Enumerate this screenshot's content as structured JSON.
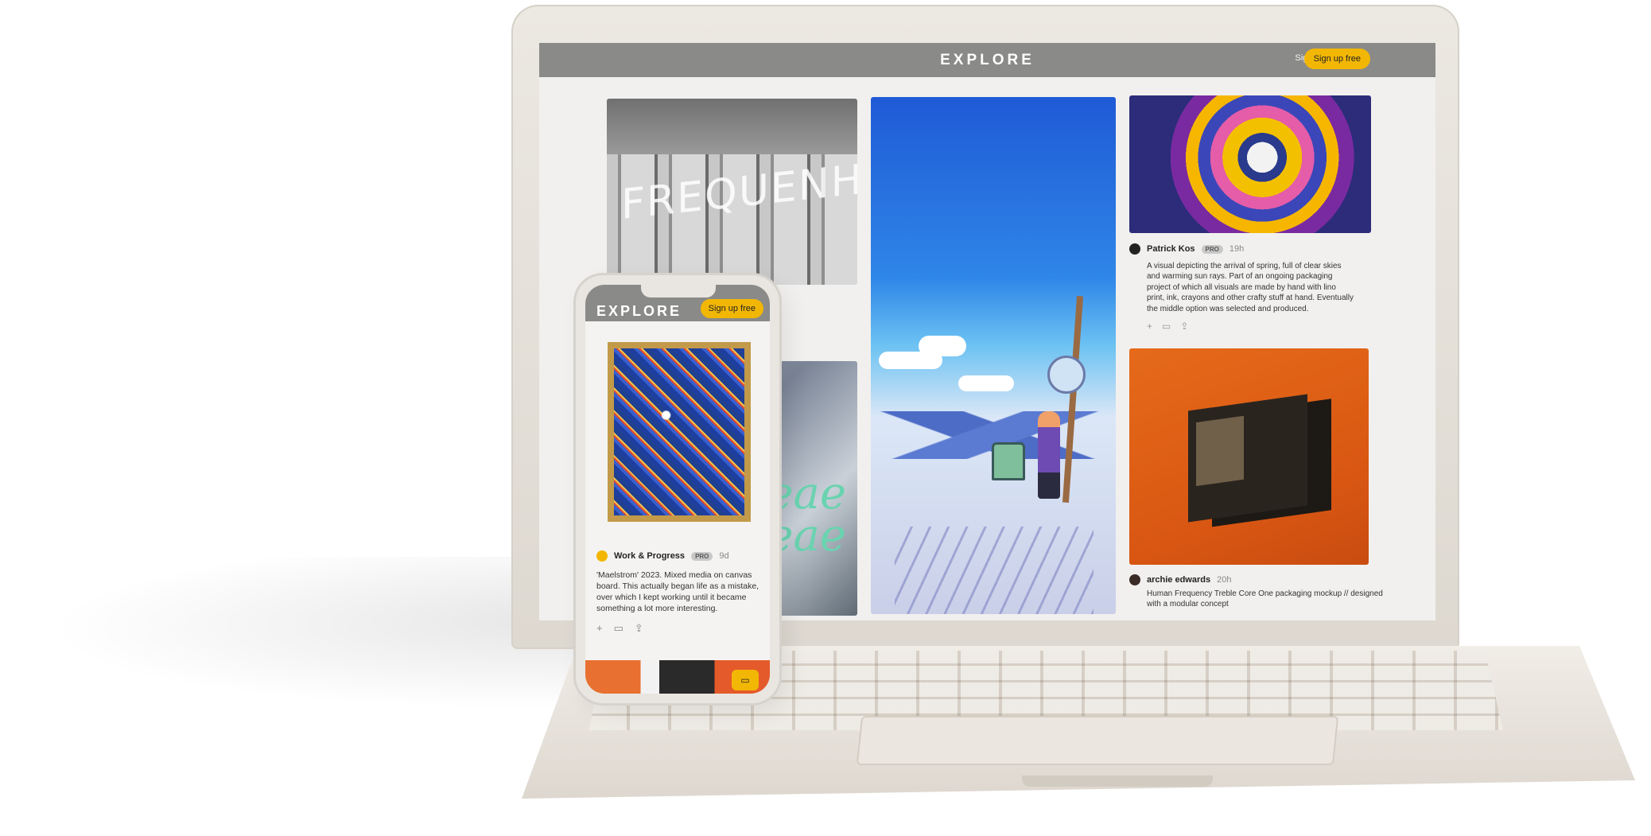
{
  "header": {
    "brand": "EXPLORE",
    "signin": "Sign in",
    "signup": "Sign up free"
  },
  "cards": {
    "frequency": {
      "text": "FREQUENHZ"
    },
    "overlay_text": "eae\neae",
    "post1": {
      "author": "Patrick Kos",
      "badge": "PRO",
      "time": "19h",
      "description": "A visual depicting the arrival of spring, full of clear skies and warming sun rays. Part of an ongoing packaging project of which all visuals are made by hand with lino print, ink, crayons and other crafty stuff at hand. Eventually the middle option was selected and produced."
    },
    "post2": {
      "author": "archie edwards",
      "time": "20h",
      "description": "Human Frequency Treble Core One packaging mockup // designed with a modular concept"
    }
  },
  "phone": {
    "brand": "EXPLORE",
    "signup": "Sign up free",
    "post": {
      "author": "Work & Progress",
      "badge": "PRO",
      "time": "9d",
      "description": "'Maelstrom' 2023. Mixed media on canvas board. This actually began life as a mistake, over which I kept working until it became something a lot more interesting."
    }
  },
  "icons": [
    "plus-icon",
    "comment-icon",
    "share-icon"
  ],
  "colors": {
    "accent": "#f2b705",
    "topbar": "#8a8a88"
  }
}
